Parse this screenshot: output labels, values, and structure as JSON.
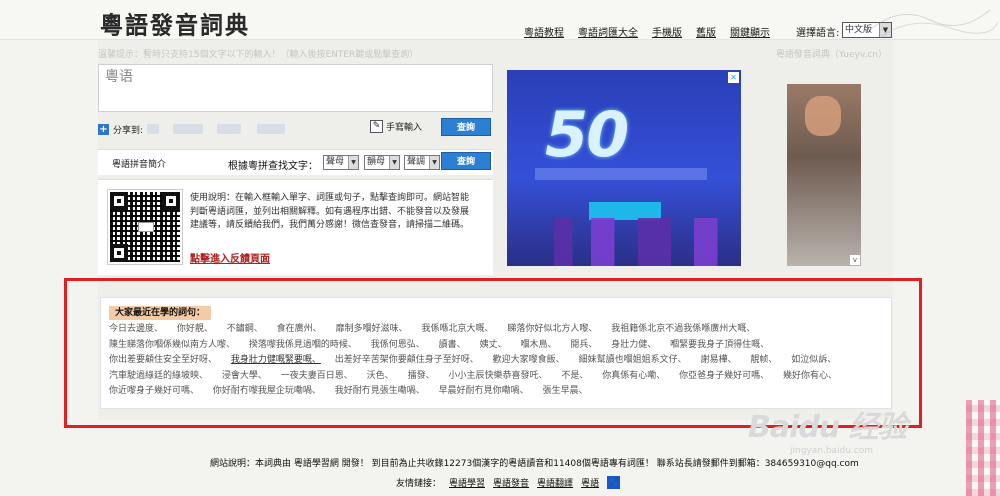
{
  "header": {
    "logo": "粵語發音詞典",
    "nav": [
      "粵語教程",
      "粵語詞匯大全",
      "手機版",
      "舊版",
      "關鍵顯示"
    ],
    "lang_label": "選擇語言:",
    "lang_value": "中文版"
  },
  "main": {
    "notice": "溫馨提示：暫時只支持15個文字以下的輸入！（輸入後按ENTER鍵或點擊查詢）",
    "site_tag": "粵語發音詞典（Yueyv.cn）",
    "input_value": "粵语",
    "share_label": "分享到:",
    "handwrite_label": "手寫輸入",
    "query_label": "查詢",
    "pinyin_intro": "粵語拼音簡介",
    "pinyin_search_label": "根據粵拼查找文字：",
    "selects": [
      "聲母",
      "韻母",
      "聲調"
    ],
    "usage": "使用說明：在輸入框輸入單字、詞匯或句子，點擊查詢即可。網站智能判斷粵語詞匯，並列出相關解釋。如有遇程序出錯、不能發音以及發展建議等，請反饋給我們，我們萬分感謝！微信查發音，請掃描二維碼。",
    "feedback_link": "點擊進入反饋頁面"
  },
  "recent": {
    "title": "大家最近在學的詞句：",
    "words": [
      "今日去邊度、",
      "你好靚、",
      "不鏽鋼、",
      "食在廣州、",
      "靡制多嗰好滋味、",
      "我係喺北京大嘅、",
      "睇落你好似北方人嚟、",
      "我祖籍係北京不過我係喺廣州大嘅、",
      "陳生睇落你嗰係幾似南方人嚟、",
      "揆落嚟我係見過嗰的時候、",
      "我係何恩弘、",
      "讀書、",
      "姨丈、",
      "嗰木鳥、",
      "閱兵、",
      "身壯力健、",
      "嗰緊要我身子頂得住嘅、",
      "你出差要顧住安全至好呀、",
      "我身壯力健嘅緊要嘅、",
      "出差好辛苦架你要顧住身子至好呀、",
      "歡迎大家嚟食飯、",
      "細妹幫讀也嗰姐姐系文仔、",
      "謝易樺、",
      "靚帧、",
      "如泣似訴、",
      "汽車駛過綠廷的綠坡映、",
      "浸會大學、",
      "一夜夫妻百日恩、",
      "沃色、",
      "擂發、",
      "小小主辰快樂恭喜發吒、",
      "不是、",
      "你真係有心嘞、",
      "你亞爸身子幾好可嗎、",
      "幾好你有心、",
      "你近嚟身子幾好可嗎、",
      "你好耐冇嚟我屋企玩嘞喎、",
      "我好耐冇見張生嘞喎、",
      "早晨好耐冇見你嘞喎、",
      "張生早晨、"
    ]
  },
  "footer": {
    "line1": "網站說明：本詞典由 粵語學習網 開發！ 到目前為止共收錄12273個漢字的粵語讀音和11408個粵語專有詞匯！ 聯系站長請發郵件到郵箱：384659310@qq.com",
    "links_label": "友情鏈接：",
    "links": [
      "粵語學習",
      "粵語發音",
      "粵語翻譯",
      "粵語"
    ]
  },
  "watermark": {
    "text": "Baidu 经验",
    "url": "jingyan.baidu.com"
  },
  "ad": {
    "headline": "50"
  }
}
